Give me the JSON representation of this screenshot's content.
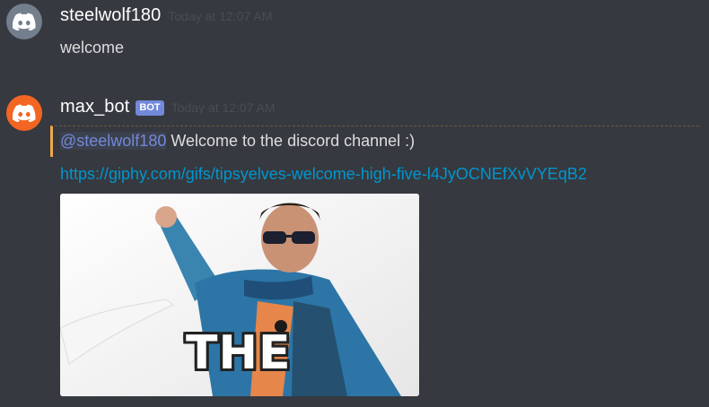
{
  "messages": [
    {
      "username": "steelwolf180",
      "timestamp": "Today at 12:07 AM",
      "avatar_icon": "discord-logo-icon",
      "avatar_color": "#747f8d",
      "text": "welcome"
    },
    {
      "username": "max_bot",
      "bot_tag": "BOT",
      "timestamp": "Today at 12:07 AM",
      "avatar_icon": "discord-logo-icon",
      "avatar_color": "#f26522",
      "embed": {
        "mention": "@steelwolf180",
        "text": " Welcome to the discord channel :)",
        "accent_color": "#f0a84a"
      },
      "link": "https://giphy.com/gifs/tipsyelves-welcome-high-five-l4JyOCNEfXvVYEqB2",
      "gif": {
        "caption": "THE"
      }
    }
  ],
  "colors": {
    "background": "#36393f",
    "username": "#ffffff",
    "message_text": "#dcddde",
    "timestamp": "#4a4d54",
    "link": "#0096cf",
    "mention": "#7289da",
    "bot_tag": "#7289da"
  }
}
